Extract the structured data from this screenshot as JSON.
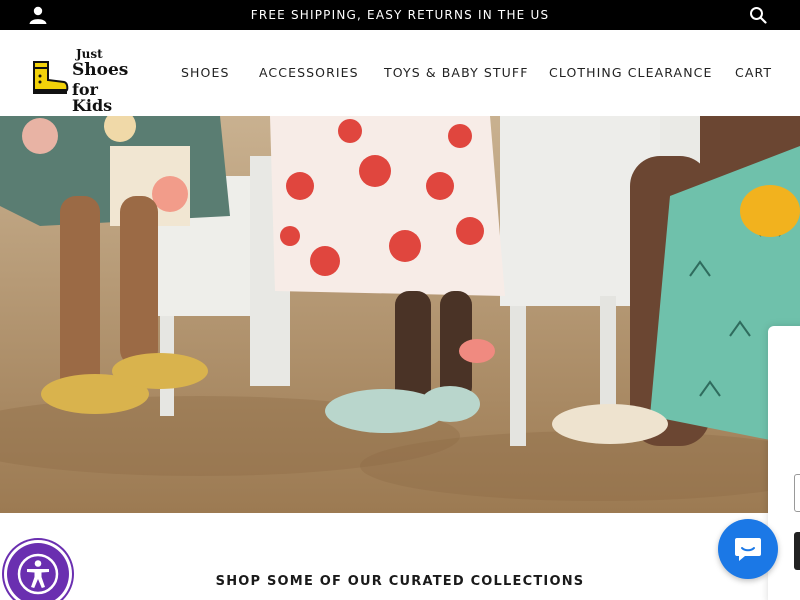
{
  "announcement": {
    "text": "FREE SHIPPING, EASY RETURNS IN THE US",
    "account_icon": "user-icon",
    "search_icon": "search-icon"
  },
  "header": {
    "logo": {
      "line1": "Just",
      "line2": "Shoes",
      "line3": "for Kids",
      "icon": "yellow-boot-icon"
    },
    "nav": [
      "SHOES",
      "ACCESSORIES",
      "TOYS & BABY STUFF",
      "CLOTHING CLEARANCE",
      "CART"
    ]
  },
  "hero": {
    "image": "kids-wearing-jelly-sandals-on-sand-photo"
  },
  "sections": {
    "collections_heading": "SHOP SOME OF OUR CURATED COLLECTIONS"
  },
  "widgets": {
    "accessibility_icon": "accessibility-icon",
    "chat_icon": "chat-icon"
  },
  "colors": {
    "announcement_bg": "#000000",
    "accessibility_purple": "#6a2fb0",
    "chat_blue": "#1b78e6",
    "logo_yellow": "#f2d20a"
  }
}
